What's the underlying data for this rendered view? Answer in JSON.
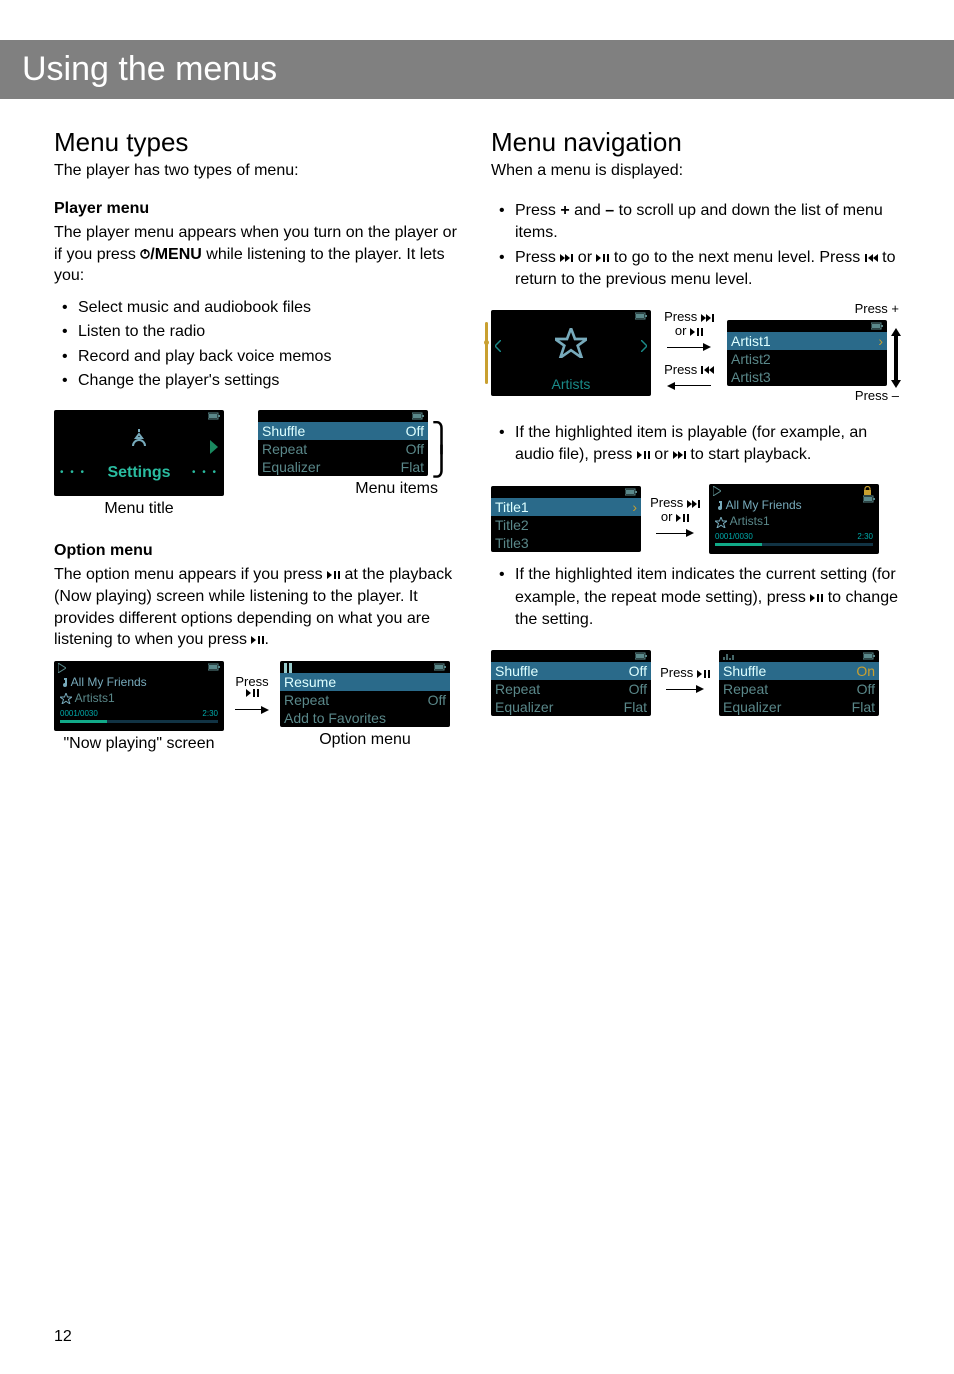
{
  "page_title": "Using the menus",
  "left": {
    "h2": "Menu types",
    "sub": "The player has two types of menu:",
    "player_menu": {
      "heading": "Player menu",
      "intro_a": "The player menu appears when you turn on the player or if you press ",
      "intro_b": "/MENU",
      "intro_c": " while listening to the player. It lets you:",
      "bullets": [
        "Select music and audiobook files",
        "Listen to the radio",
        "Record and play back voice memos",
        "Change the player's settings"
      ],
      "screen_settings": {
        "title": "Settings"
      },
      "menu_items": {
        "shuffle": "Shuffle",
        "shuffle_v": "Off",
        "repeat": "Repeat",
        "repeat_v": "Off",
        "equalizer": "Equalizer",
        "equalizer_v": "Flat"
      },
      "caption_title": "Menu title",
      "caption_items": "Menu items"
    },
    "option_menu": {
      "heading": "Option menu",
      "intro_a": "The option menu appears if you press ",
      "intro_b": " at the playback (Now playing) screen while listening to the player. It provides different options depending on what you are listening to when you press ",
      "np": {
        "track": "All My Friends",
        "artist": "Artists1",
        "counter": "0001/0030",
        "time": "2:30"
      },
      "press": "Press",
      "opt": {
        "resume": "Resume",
        "repeat": "Repeat",
        "repeat_v": "Off",
        "fav": "Add to Favorites"
      },
      "caption_np": "\"Now playing\" screen",
      "caption_opt": "Option menu"
    }
  },
  "right": {
    "h2": "Menu navigation",
    "sub": "When a menu is displayed:",
    "bullets1": {
      "b1a": "Press ",
      "b1plus": "+",
      "b1b": " and ",
      "b1minus": "–",
      "b1c": " to scroll up and down the list of menu items.",
      "b2a": "Press ",
      "b2b": " or ",
      "b2c": " to go to the next menu level. Press ",
      "b2d": " to return to the previous menu level."
    },
    "diagram1": {
      "artists": "Artists",
      "a1": "Artist1",
      "a2": "Artist2",
      "a3": "Artist3",
      "p_fwd": "Press ",
      "p_or": "or ",
      "p_back": "Press ",
      "p_plus": "Press +",
      "p_minus": "Press –"
    },
    "bullet2": {
      "a": "If the highlighted item is playable (for example, an audio file), press ",
      "b": " or ",
      "c": " to start playback."
    },
    "diagram2": {
      "t1": "Title1",
      "t2": "Title2",
      "t3": "Title3",
      "np_track": "All My Friends",
      "np_artist": "Artists1",
      "np_counter": "0001/0030",
      "np_time": "2:30",
      "p_fwd": "Press ",
      "p_or": "or "
    },
    "bullet3": {
      "a": "If the highlighted item indicates the current setting (for example, the repeat mode setting), press ",
      "b": " to change the setting."
    },
    "diagram3": {
      "shuffle": "Shuffle",
      "repeat": "Repeat",
      "equalizer": "Equalizer",
      "off": "Off",
      "flat": "Flat",
      "on": "On",
      "press": "Press "
    }
  },
  "page_number": "12"
}
